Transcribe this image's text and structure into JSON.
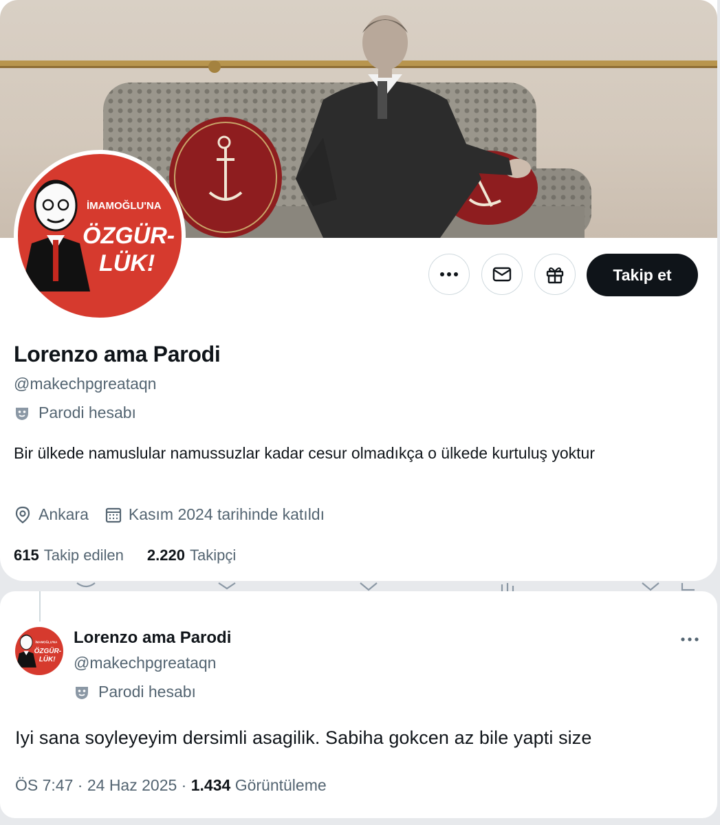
{
  "profile": {
    "avatar_text_top": "İMAMOĞLU'NA",
    "avatar_text_mid": "ÖZGÜR-",
    "avatar_text_bot": "LÜK!",
    "display_name": "Lorenzo ama Parodi",
    "handle": "@makechpgreataqn",
    "parody_label": "Parodi hesabı",
    "bio": "Bir ülkede namuslular namussuzlar kadar cesur olmadıkça o ülkede kurtuluş yoktur",
    "location": "Ankara",
    "joined": "Kasım 2024 tarihinde katıldı",
    "following_count": "615",
    "following_label": "Takip edilen",
    "followers_count": "2.220",
    "followers_label": "Takipçi"
  },
  "actions": {
    "more_icon": "more-horizontal-icon",
    "message_icon": "envelope-icon",
    "gift_icon": "gift-icon",
    "follow_label": "Takip et"
  },
  "tweet": {
    "author_name": "Lorenzo ama Parodi",
    "author_handle": "@makechpgreataqn",
    "parody_label": "Parodi hesabı",
    "text": "Iyi sana soyleyeyim dersimli asagilik. Sabiha gokcen az bile yapti size",
    "time": "ÖS 7:47",
    "date": "24 Haz 2025",
    "views_count": "1.434",
    "views_label": "Görüntüleme"
  },
  "colors": {
    "avatar_red": "#d63a2e",
    "text_primary": "#0f1419",
    "text_secondary": "#536471",
    "follow_button": "#0f1419"
  }
}
